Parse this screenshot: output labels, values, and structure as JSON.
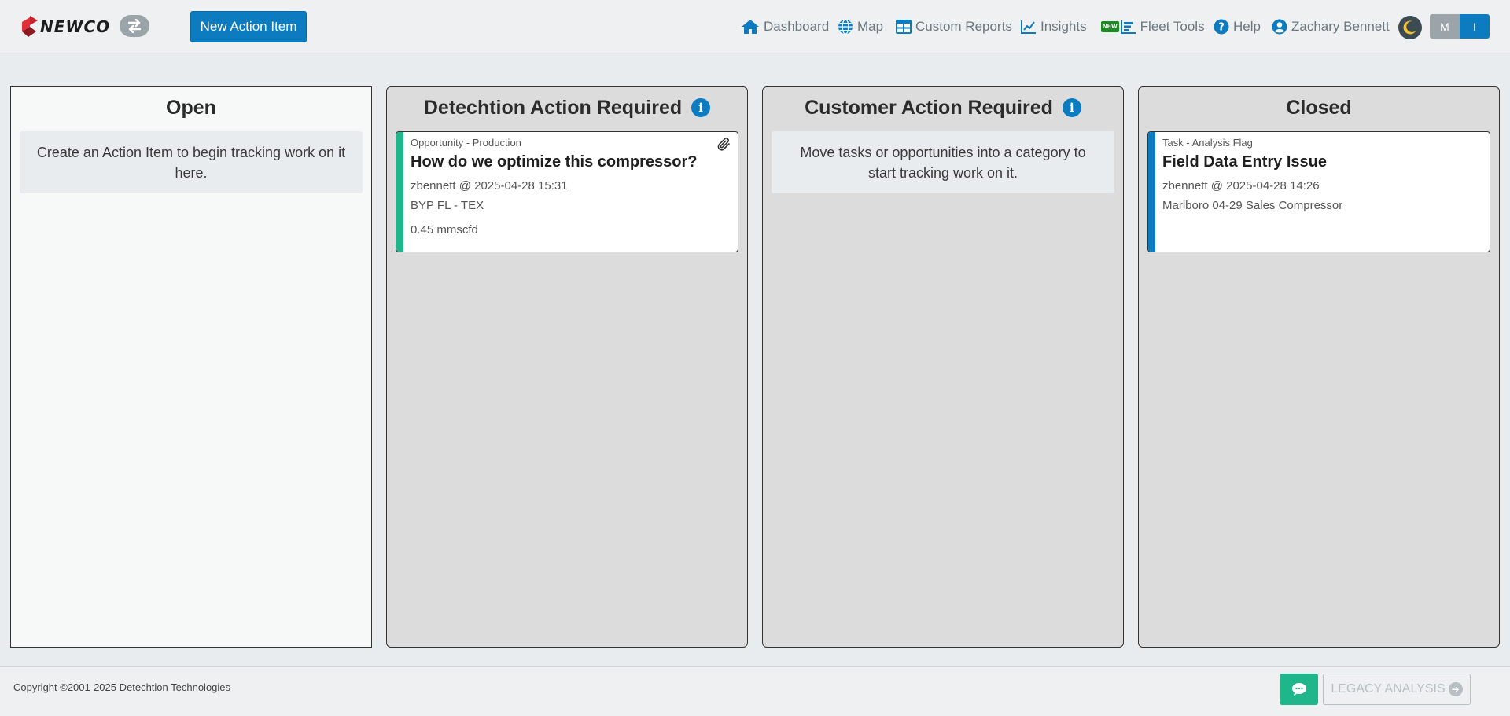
{
  "header": {
    "logo_text": "NEWCO",
    "new_action_label": "New Action Item",
    "nav": [
      {
        "label": "Dashboard",
        "icon": "home-icon"
      },
      {
        "label": "Map",
        "icon": "globe-icon"
      },
      {
        "label": "Custom Reports",
        "icon": "table-icon"
      },
      {
        "label": "Insights",
        "icon": "line-chart-icon"
      },
      {
        "label": "Fleet Tools",
        "icon": "bar-list-icon",
        "badge": "NEW"
      },
      {
        "label": "Help",
        "icon": "question-icon"
      },
      {
        "label": "Zachary Bennett",
        "icon": "user-icon"
      }
    ],
    "units": {
      "metric": "M",
      "imperial": "I",
      "selected": "I"
    }
  },
  "board": {
    "columns": [
      {
        "title": "Open",
        "info": false,
        "empty_message": "Create an Action Item to begin tracking work on it here."
      },
      {
        "title": "Detechtion Action Required",
        "info": true
      },
      {
        "title": "Customer Action Required",
        "info": true,
        "empty_message": "Move tasks or opportunities into a category to start tracking work on it."
      },
      {
        "title": "Closed",
        "info": false
      }
    ],
    "cards": {
      "detechtion": {
        "type": "Opportunity - Production",
        "title": "How do we optimize this compressor?",
        "meta": "zbennett @ 2025-04-28 15:31",
        "location": "BYP FL - TEX",
        "value": "0.45 mmscfd",
        "stripe_color": "#20b68c",
        "has_attachment": true
      },
      "closed": {
        "type": "Task - Analysis Flag",
        "title": "Field Data Entry Issue",
        "meta": "zbennett @ 2025-04-28 14:26",
        "location": "Marlboro 04-29 Sales Compressor",
        "stripe_color": "#0d7bbf"
      }
    }
  },
  "footer": {
    "copyright": "Copyright ©2001-2025 Detechtion Technologies",
    "legacy_label": "LEGACY ANALYSIS"
  },
  "colors": {
    "accent": "#0d7bbf",
    "success": "#20b68c",
    "nav_text": "#6b7880"
  }
}
